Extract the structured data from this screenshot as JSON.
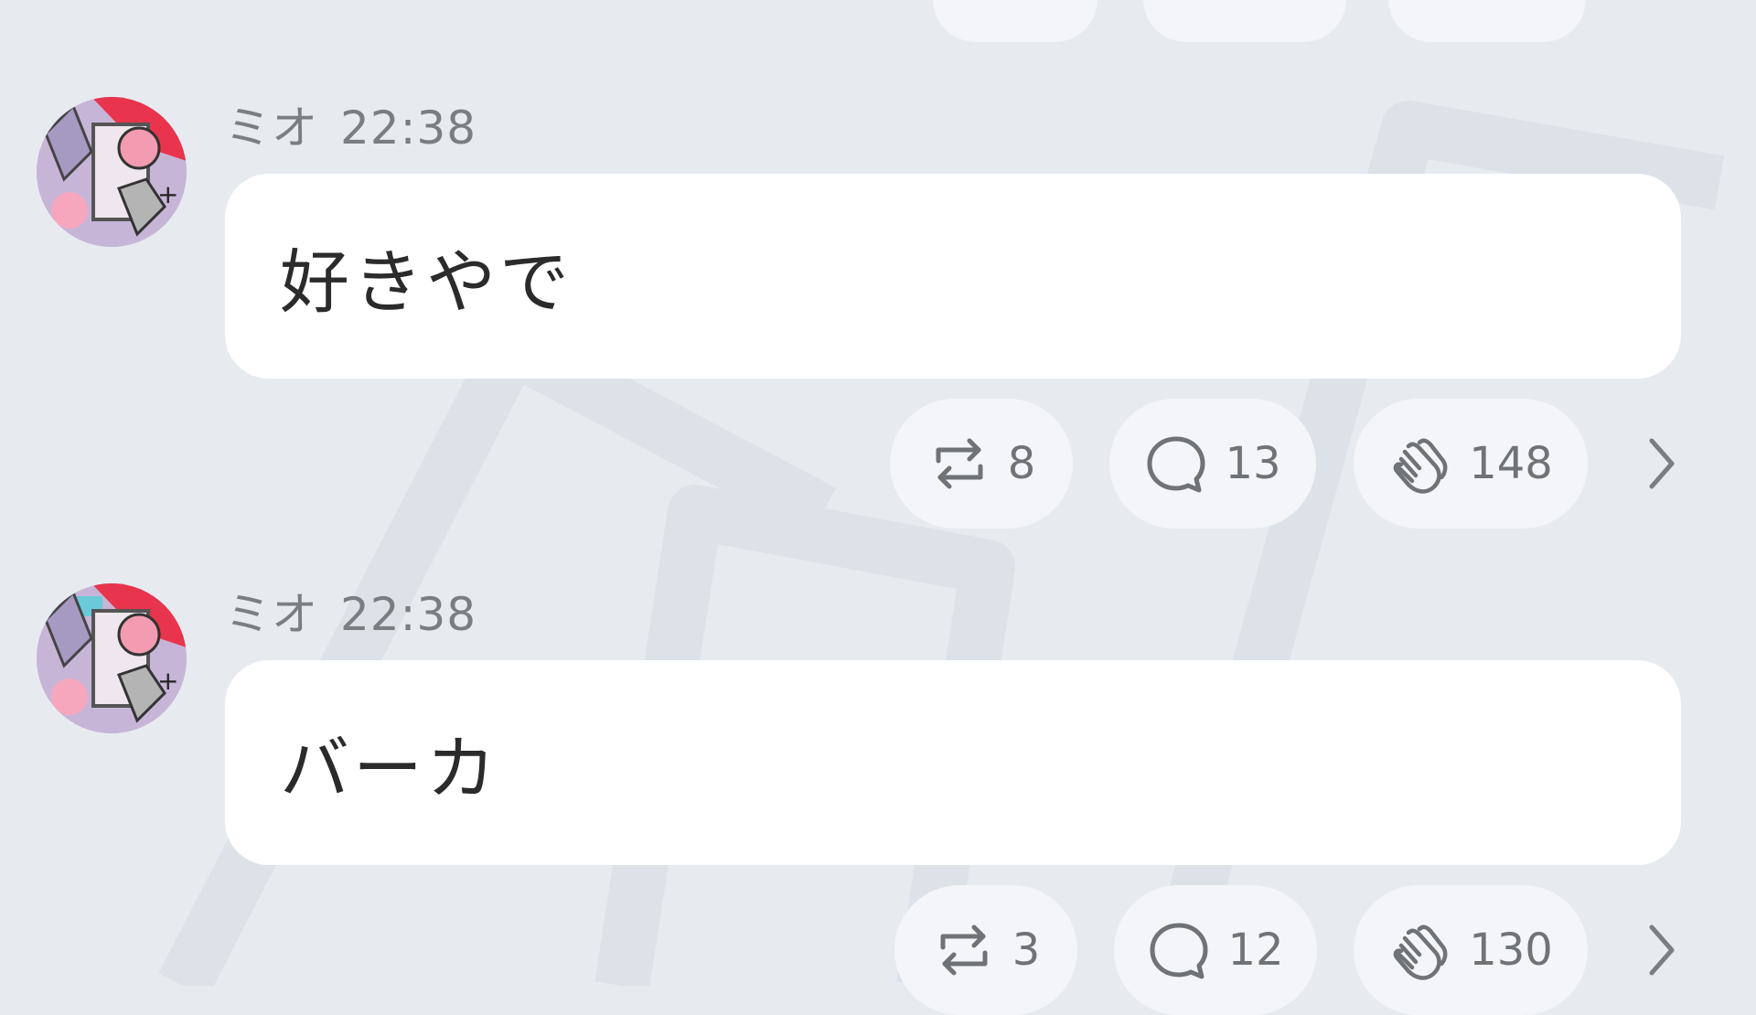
{
  "messages": [
    {
      "author": "ミオ",
      "time": "22:38",
      "text": "好きやで",
      "repost_count": "8",
      "reply_count": "13",
      "clap_count": "148"
    },
    {
      "author": "ミオ",
      "time": "22:38",
      "text": "バーカ",
      "repost_count": "3",
      "reply_count": "12",
      "clap_count": "130"
    }
  ],
  "icons": {
    "repost": "repost-icon",
    "reply": "comment-icon",
    "clap": "clap-icon",
    "more": "chevron-right-icon"
  },
  "colors": {
    "background": "#e7ebf0",
    "bubble": "#ffffff",
    "pill": "#f3f5f8",
    "meta_text": "#7b7d81",
    "count_text": "#6f7277"
  }
}
